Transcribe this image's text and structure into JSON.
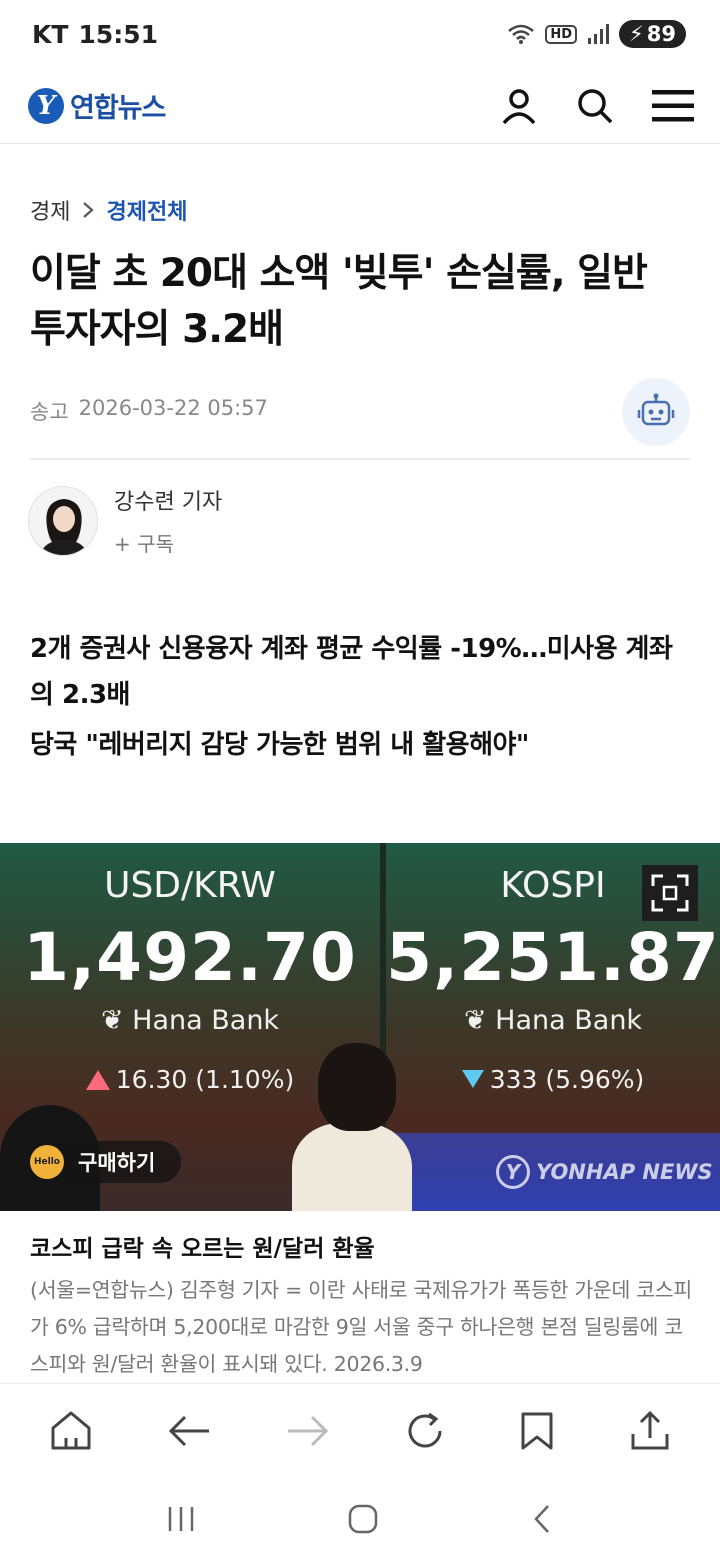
{
  "status": {
    "carrier": "KT",
    "time": "15:51",
    "battery": "89"
  },
  "header": {
    "logo_text": "연합뉴스"
  },
  "breadcrumb": {
    "section": "경제",
    "subsection": "경제전체"
  },
  "article": {
    "headline": "이달 초 20대 소액 '빚투' 손실률, 일반 투자자의 3.2배",
    "date_label": "송고",
    "date": "2026-03-22 05:57",
    "author": "강수련 기자",
    "subscribe": "+ 구독",
    "summary": [
      "2개 증권사 신용융자 계좌 평균 수익률 -19%…미사용 계좌의 2.3배",
      "당국 \"레버리지 감당 가능한 범위 내 활용해야\""
    ]
  },
  "photo": {
    "left_board": {
      "pair": "USD/KRW",
      "value": "1,492.70",
      "bank": "Hana Bank",
      "change": "16.30 (1.10%)"
    },
    "right_board": {
      "pair": "KOSPI",
      "value": "5,251.87",
      "bank": "Hana Bank",
      "change": "333 (5.96%)"
    },
    "buy_label": "구매하기",
    "hello_badge": "Hello",
    "watermark": "YONHAP NEWS",
    "caption_title": "코스피 급락 속 오르는 원/달러 환율",
    "caption": "(서울=연합뉴스) 김주형 기자 = 이란 사태로 국제유가가 폭등한 가운데 코스피가 6% 급락하며 5,200대로 마감한 9일 서울 중구 하나은행 본점 딜링룸에 코스피와 원/달러 환율이 표시돼 있다. 2026.3.9"
  },
  "colors": {
    "brand": "#1a4fa3",
    "up": "#ff6b7a",
    "down": "#5fc9f0"
  }
}
